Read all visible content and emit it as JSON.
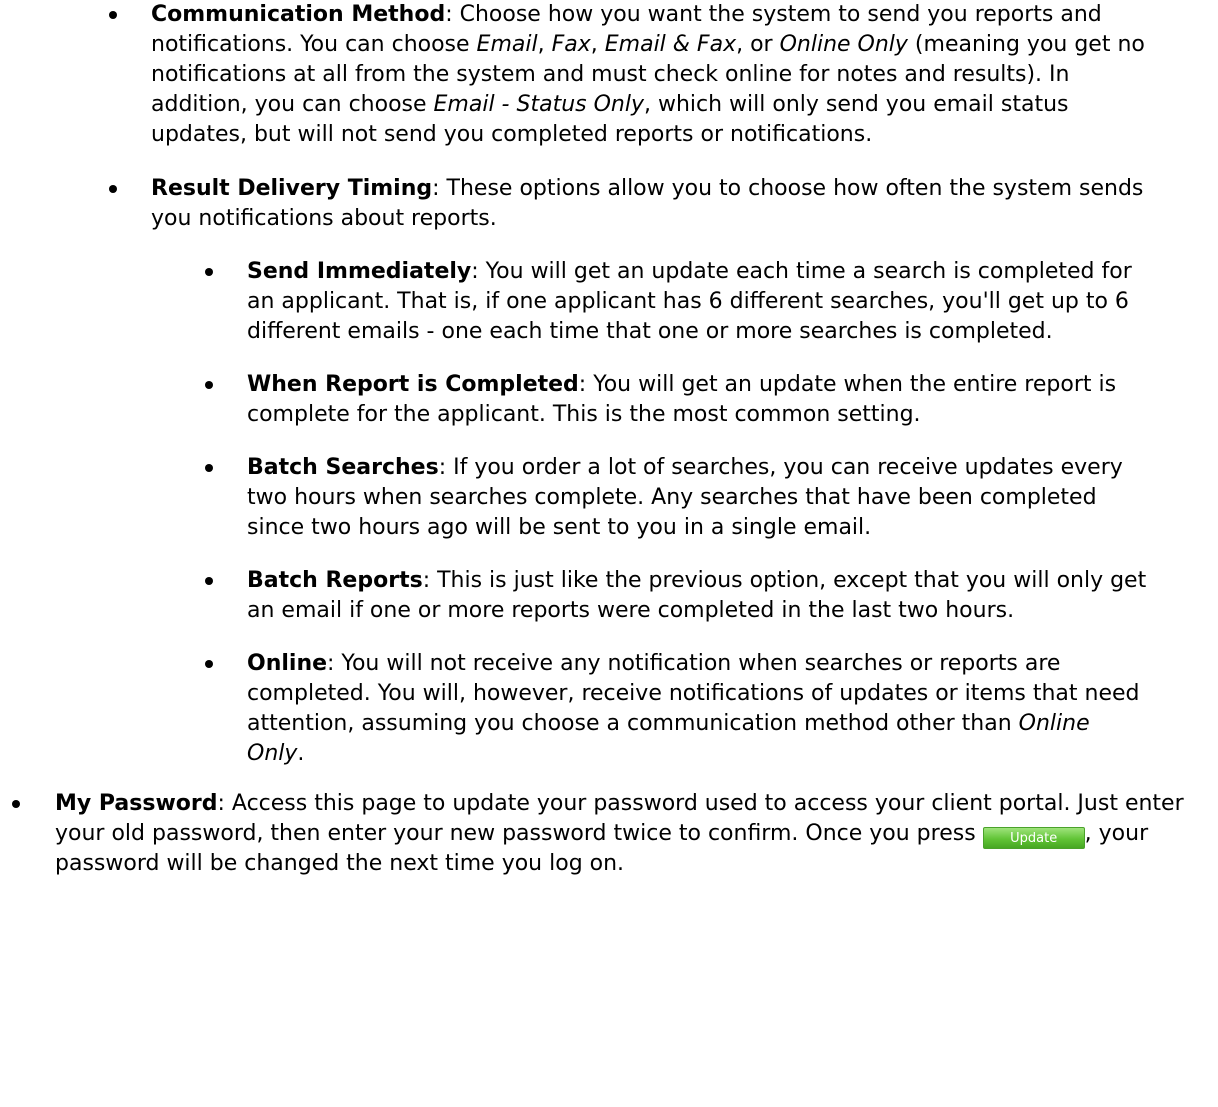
{
  "communication": {
    "title": "Communication Method",
    "t1": ": Choose how you want the system to send you reports and notifications. You can choose ",
    "opt_email": "Email",
    "sep1": ", ",
    "opt_fax": "Fax",
    "sep2": ", ",
    "opt_email_fax": "Email & Fax",
    "sep3": ", or ",
    "opt_online_only": "Online Only",
    "t2": " (meaning you get no notifications at all from the system and must check online for notes and results). In addition, you can choose ",
    "opt_status_only": "Email - Status Only",
    "t3": ", which will only send you email status updates, but will not send you completed reports or notifications."
  },
  "timing": {
    "title": "Result Delivery Timing",
    "text": ": These options allow you to choose how often the system sends you notifications about reports.",
    "options": [
      {
        "title": "Send Immediately",
        "text": ": You will get an update each time a search is completed for an applicant. That is, if one applicant has 6 different searches, you'll get up to 6 different emails - one each time that one or more searches is completed."
      },
      {
        "title": "When Report is Completed",
        "text": ": You will get an update when the entire report is complete for the applicant. This is the most common setting."
      },
      {
        "title": "Batch Searches",
        "text": ": If you order a lot of searches, you can receive updates every two hours when searches complete. Any searches that have been completed since two hours ago will be sent to you in a single email."
      },
      {
        "title": "Batch Reports",
        "text": ": This is just like the previous option, except that you will only get an email if one or more reports were completed in the last two hours."
      },
      {
        "title": "Online",
        "text": ": You will not receive any notification when searches or reports are completed. You will, however, receive notifications of updates or items that need attention, assuming you choose a communication method other than ",
        "emph": "Online Only",
        "end": "."
      }
    ]
  },
  "password": {
    "title": "My Password",
    "t1": ": Access this page to update your password used to access your client portal. Just enter your old password, then enter your new password twice to confirm. Once you press ",
    "button_label": "Update",
    "t2": ", your password will be changed the next time you log on."
  }
}
